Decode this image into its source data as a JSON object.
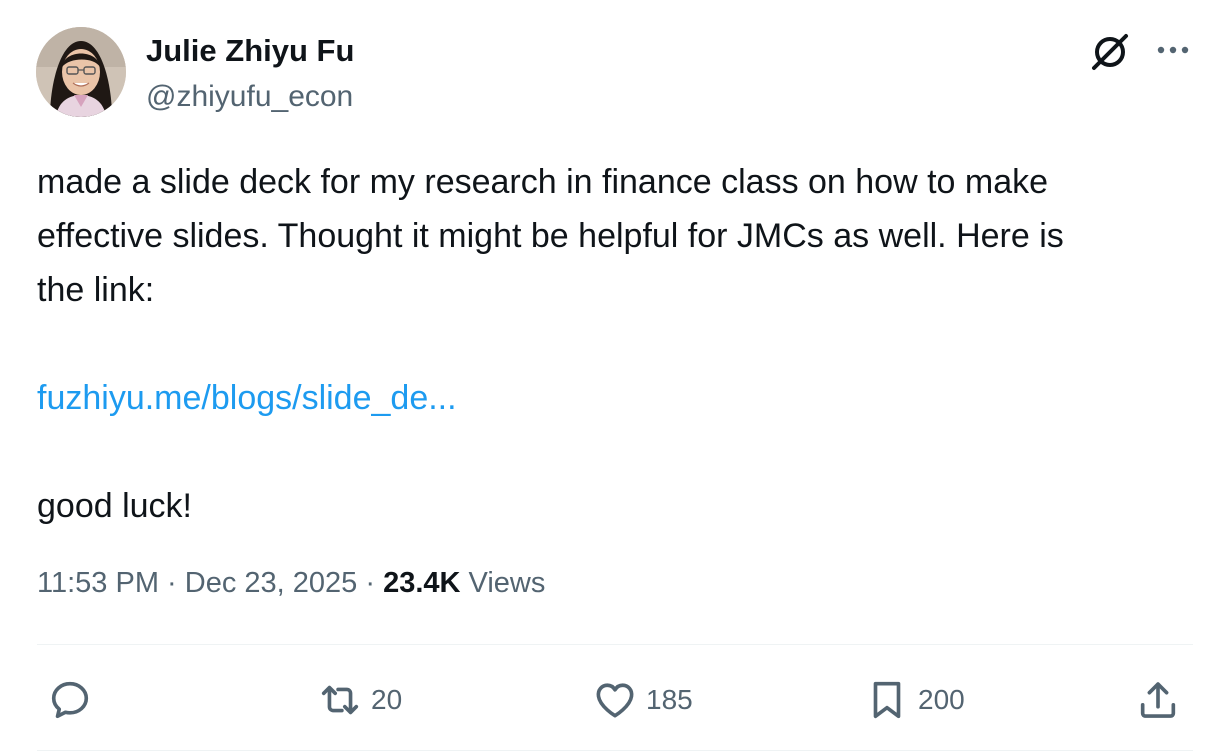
{
  "author": {
    "display_name": "Julie Zhiyu Fu",
    "handle": "@zhiyufu_econ",
    "avatar": "profile-photo"
  },
  "header_icons": {
    "grok": "grok-icon",
    "more": "more-icon"
  },
  "tweet": {
    "line_1": "made a slide deck for my research in finance class on how to make",
    "line_2": "effective slides. Thought it might be helpful for JMCs  as well. Here is",
    "line_3": "the link:",
    "link": "fuzhiyu.me/blogs/slide_de...",
    "closing": "good luck!"
  },
  "meta": {
    "time": "11:53 PM",
    "separator": "·",
    "date": "Dec 23, 2025",
    "views_count": "23.4K",
    "views_label": "Views"
  },
  "actions": {
    "reply": {
      "icon": "reply-icon",
      "count": ""
    },
    "repost": {
      "icon": "repost-icon",
      "count": "20"
    },
    "like": {
      "icon": "heart-icon",
      "count": "185"
    },
    "bookmark": {
      "icon": "bookmark-icon",
      "count": "200"
    },
    "share": {
      "icon": "share-icon",
      "count": ""
    }
  },
  "colors": {
    "text_primary": "#0f1419",
    "text_secondary": "#536471",
    "link": "#1d9bf0",
    "divider": "#eff3f4"
  }
}
